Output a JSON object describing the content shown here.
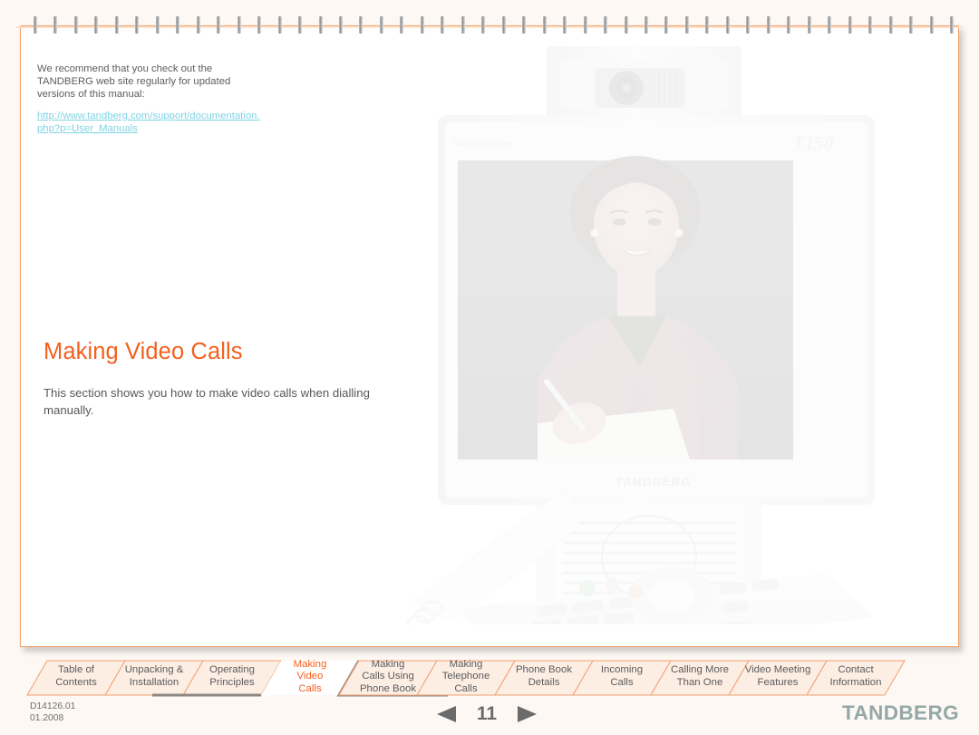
{
  "document": {
    "note_paragraph": "We recommend that you check out the TANDBERG web site regularly for updated versions of this manual:",
    "note_link": "http://www.tandberg.com/support/documentation.php?p=User_Manuals",
    "section_title": "Making Video Calls",
    "section_body": "This section shows you how to make video calls when dialling manually."
  },
  "device": {
    "model_label": "T150",
    "brand_label": "TANDBERG",
    "series_label": "Welcome Series"
  },
  "tabs": [
    {
      "id": "table-of-contents",
      "line1": "Table of",
      "line2": "Contents",
      "line3": "",
      "active": false
    },
    {
      "id": "unpacking-installation",
      "line1": "Unpacking &",
      "line2": "Installation",
      "line3": "",
      "active": false
    },
    {
      "id": "operating-principles",
      "line1": "Operating",
      "line2": "Principles",
      "line3": "",
      "active": false
    },
    {
      "id": "making-video-calls",
      "line1": "Making",
      "line2": "Video",
      "line3": "Calls",
      "active": true
    },
    {
      "id": "making-calls-using-phone-book",
      "line1": "Making",
      "line2": "Calls Using",
      "line3": "Phone Book",
      "active": false
    },
    {
      "id": "making-telephone-calls",
      "line1": "Making",
      "line2": "Telephone",
      "line3": "Calls",
      "active": false
    },
    {
      "id": "phone-book-details",
      "line1": "Phone Book",
      "line2": "Details",
      "line3": "",
      "active": false
    },
    {
      "id": "incoming-calls",
      "line1": "Incoming",
      "line2": "Calls",
      "line3": "",
      "active": false
    },
    {
      "id": "calling-more-than-one",
      "line1": "Calling More",
      "line2": "Than One",
      "line3": "",
      "active": false
    },
    {
      "id": "video-meeting-features",
      "line1": "Video Meeting",
      "line2": "Features",
      "line3": "",
      "active": false
    },
    {
      "id": "contact-information",
      "line1": "Contact",
      "line2": "Information",
      "line3": "",
      "active": false
    }
  ],
  "footer": {
    "doc_id": "D14126.01",
    "doc_date": "01.2008",
    "page_number": "11",
    "prev_label": "◀",
    "next_label": "▶",
    "brand": "TANDBERG"
  },
  "colors": {
    "accent_orange": "#f4601e",
    "tab_fill": "#fdeee4",
    "tab_stroke": "#f0a070",
    "page_background": "#fdf8f3",
    "link_cyan": "#7fd4e4",
    "body_text": "#595959",
    "brand_gray": "#93a8a8"
  },
  "spiral": {
    "ring_count": 46
  }
}
